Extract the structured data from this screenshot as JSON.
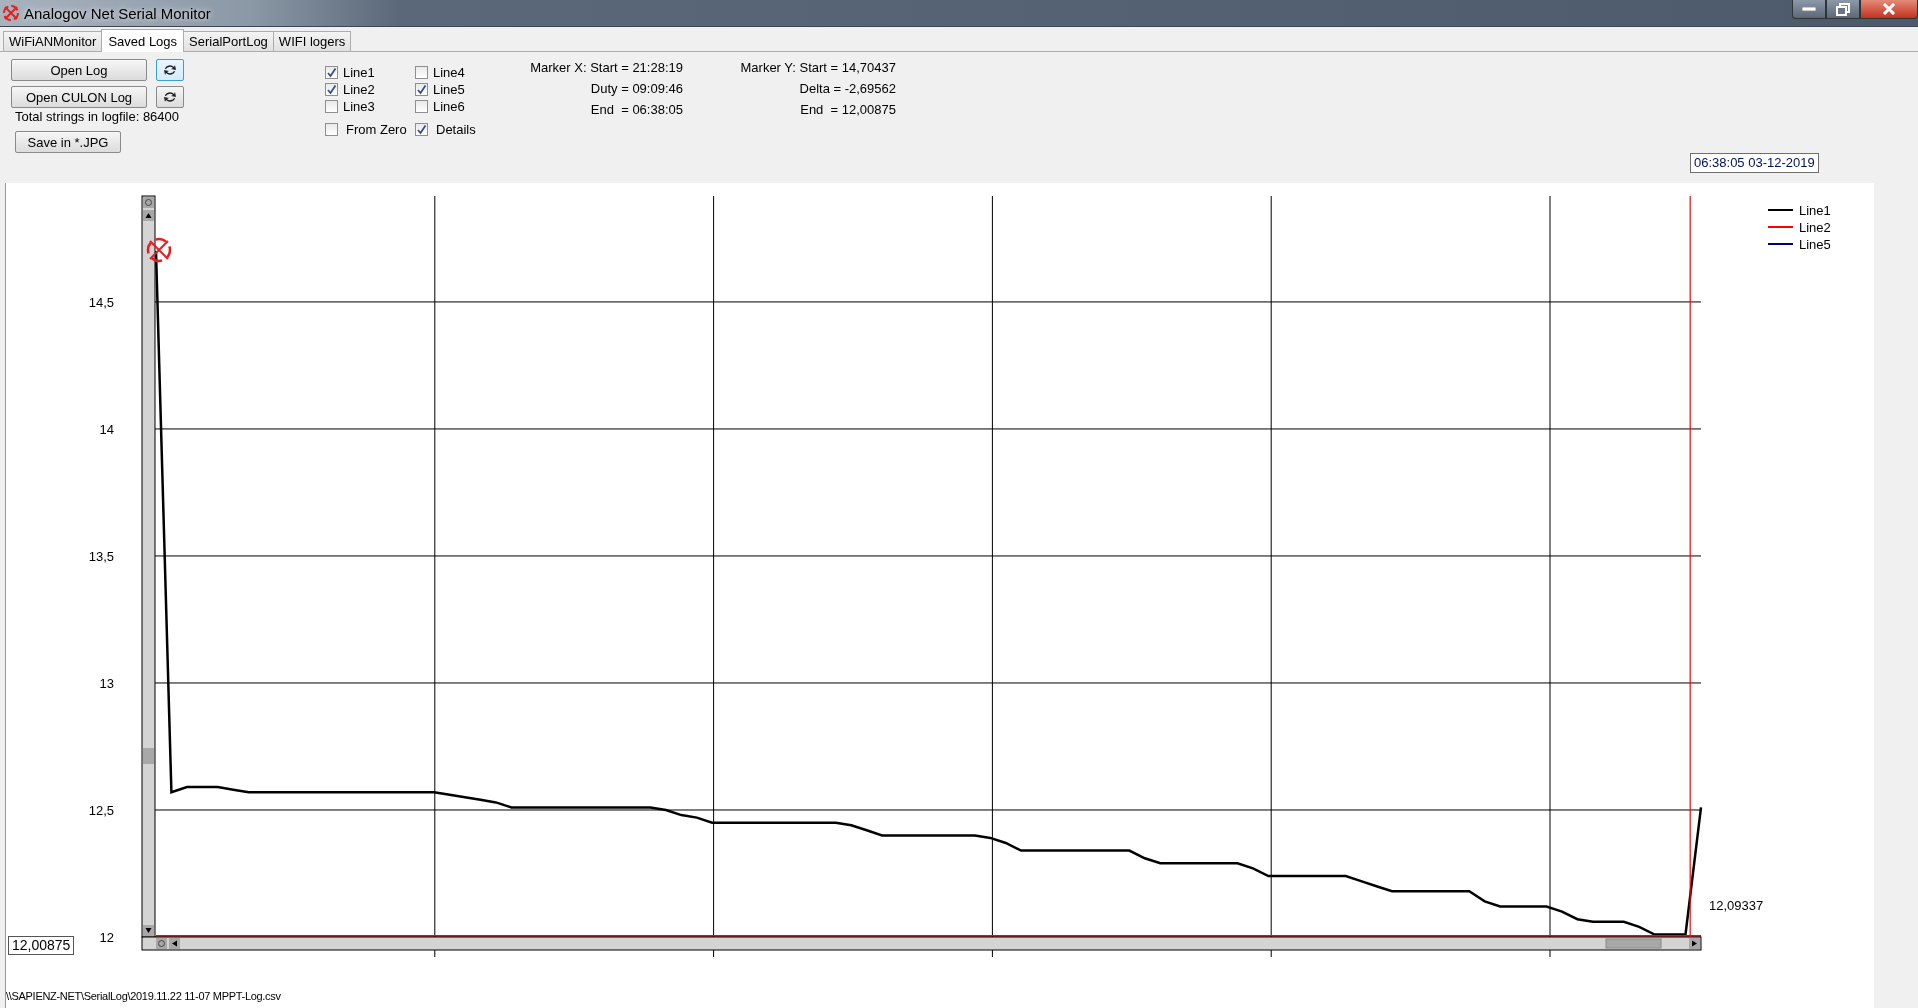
{
  "window": {
    "title": "Analogov Net Serial Monitor"
  },
  "tabs": [
    {
      "label": "WiFiANMonitor",
      "selected": false
    },
    {
      "label": "Saved Logs",
      "selected": true
    },
    {
      "label": "SerialPortLog",
      "selected": false
    },
    {
      "label": "WIFI logers",
      "selected": false
    }
  ],
  "controls": {
    "open_log": "Open Log",
    "open_culon_log": "Open CULON Log",
    "total_strings": "Total strings in logfile: 86400",
    "save_jpg": "Save in *.JPG"
  },
  "line_checkboxes": [
    {
      "label": "Line1",
      "checked": true
    },
    {
      "label": "Line2",
      "checked": true
    },
    {
      "label": "Line3",
      "checked": false
    },
    {
      "label": "Line4",
      "checked": false
    },
    {
      "label": "Line5",
      "checked": true
    },
    {
      "label": "Line6",
      "checked": false
    }
  ],
  "options": [
    {
      "label": "From Zero",
      "checked": false
    },
    {
      "label": "Details",
      "checked": true
    }
  ],
  "marker_x": [
    "Marker X: Start = 21:28:19",
    "Duty = 09:09:46",
    "End  = 06:38:05"
  ],
  "marker_y": [
    "Marker Y: Start = 14,70437",
    "Delta = -2,69562",
    "End  = 12,00875"
  ],
  "timestamp": "06:38:05 03-12-2019",
  "marker_value": "12,00875",
  "chart": {
    "chart_data": {
      "type": "line",
      "ylim": [
        12,
        14.917
      ],
      "legend": "upper right",
      "yticks": [
        {
          "value": 14.5,
          "label": "14,5"
        },
        {
          "value": 14,
          "label": "14"
        },
        {
          "value": 13.5,
          "label": "13,5"
        },
        {
          "value": 13,
          "label": "13"
        },
        {
          "value": 12.5,
          "label": "12,5"
        },
        {
          "value": 12,
          "label": "12"
        }
      ],
      "series": [
        {
          "name": "Line1",
          "color": "#000000",
          "values": [
            14.7,
            12.57,
            12.59,
            12.59,
            12.59,
            12.58,
            12.57,
            12.57,
            12.57,
            12.57,
            12.57,
            12.57,
            12.57,
            12.57,
            12.57,
            12.57,
            12.57,
            12.57,
            12.57,
            12.56,
            12.55,
            12.54,
            12.53,
            12.51,
            12.51,
            12.51,
            12.51,
            12.51,
            12.51,
            12.51,
            12.51,
            12.51,
            12.51,
            12.5,
            12.48,
            12.47,
            12.45,
            12.45,
            12.45,
            12.45,
            12.45,
            12.45,
            12.45,
            12.45,
            12.45,
            12.44,
            12.42,
            12.4,
            12.4,
            12.4,
            12.4,
            12.4,
            12.4,
            12.4,
            12.39,
            12.37,
            12.34,
            12.34,
            12.34,
            12.34,
            12.34,
            12.34,
            12.34,
            12.34,
            12.31,
            12.29,
            12.29,
            12.29,
            12.29,
            12.29,
            12.29,
            12.27,
            12.24,
            12.24,
            12.24,
            12.24,
            12.24,
            12.24,
            12.22,
            12.2,
            12.18,
            12.18,
            12.18,
            12.18,
            12.18,
            12.18,
            12.14,
            12.12,
            12.12,
            12.12,
            12.12,
            12.1,
            12.07,
            12.06,
            12.06,
            12.06,
            12.04,
            12.01,
            12.01,
            12.01,
            12.51
          ]
        },
        {
          "name": "Line2",
          "color": "#ff0000",
          "values": [
            12.005,
            12.005,
            12.005,
            12.005,
            12.005,
            12.005,
            12.005,
            12.005,
            12.005,
            12.005,
            12.005,
            12.005,
            12.005,
            12.005,
            12.005,
            12.005,
            12.005,
            12.005,
            12.005,
            12.005,
            12.005,
            12.005,
            12.005,
            12.005,
            12.005,
            12.005,
            12.005,
            12.005,
            12.005,
            12.005,
            12.005,
            12.005,
            12.005,
            12.005,
            12.005,
            12.005,
            12.005,
            12.005,
            12.005,
            12.005,
            12.005,
            12.005,
            12.005,
            12.005,
            12.005,
            12.005,
            12.005,
            12.005,
            12.005,
            12.005,
            12.005,
            12.005,
            12.005,
            12.005,
            12.005,
            12.005,
            12.005,
            12.005,
            12.005,
            12.005,
            12.005,
            12.005,
            12.005,
            12.005,
            12.005,
            12.005,
            12.005,
            12.005,
            12.005,
            12.005,
            12.005,
            12.005,
            12.005,
            12.005,
            12.005,
            12.005,
            12.005,
            12.005,
            12.005,
            12.005,
            12.005,
            12.005,
            12.005,
            12.005,
            12.005,
            12.005,
            12.005,
            12.005,
            12.005,
            12.005,
            12.005,
            12.005,
            12.005,
            12.005,
            12.005,
            12.005,
            12.005,
            12.005,
            12.005,
            12.005,
            12.005
          ]
        },
        {
          "name": "Line5",
          "color": "#000080",
          "values": [
            null,
            null
          ]
        }
      ],
      "annotations": [
        "12,09337"
      ]
    }
  },
  "status_path": "\\\\SAPIENZ-NET\\SerialLog\\2019.11.22 11-07 MPPT-Log.csv"
}
